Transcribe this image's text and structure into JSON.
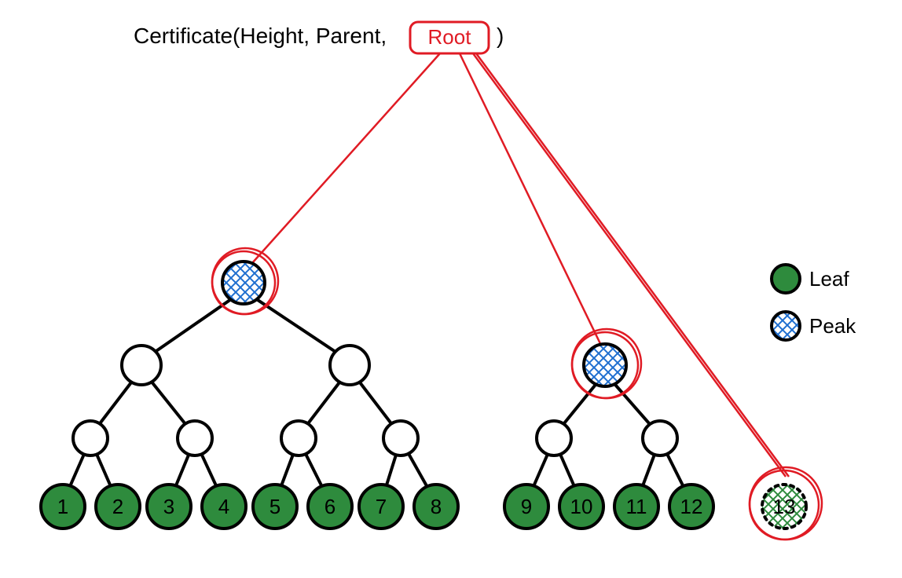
{
  "title": {
    "prefix": "Certificate(Height, Parent, ",
    "root": "Root",
    "suffix": ")"
  },
  "legend": {
    "leaf": "Leaf",
    "peak": "Peak"
  },
  "colors": {
    "leaf_fill": "#2e8b3d",
    "node_stroke": "#000000",
    "peak_hatch": "#1f6fd0",
    "root_red": "#e01b24",
    "dotted_hatch": "#2e8b3d"
  },
  "tree": {
    "leaves": [
      {
        "id": 1,
        "label": "1"
      },
      {
        "id": 2,
        "label": "2"
      },
      {
        "id": 3,
        "label": "3"
      },
      {
        "id": 4,
        "label": "4"
      },
      {
        "id": 5,
        "label": "5"
      },
      {
        "id": 6,
        "label": "6"
      },
      {
        "id": 7,
        "label": "7"
      },
      {
        "id": 8,
        "label": "8"
      },
      {
        "id": 9,
        "label": "9"
      },
      {
        "id": 10,
        "label": "10"
      },
      {
        "id": 11,
        "label": "11"
      },
      {
        "id": 12,
        "label": "12"
      },
      {
        "id": 13,
        "label": "13"
      }
    ],
    "peaks": [
      {
        "name": "peak-left",
        "covers": [
          1,
          2,
          3,
          4,
          5,
          6,
          7,
          8
        ]
      },
      {
        "name": "peak-mid",
        "covers": [
          9,
          10,
          11,
          12
        ]
      },
      {
        "name": "peak-right",
        "covers": [
          13
        ]
      }
    ],
    "root_connects_to": [
      "peak-left",
      "peak-mid",
      "peak-right"
    ]
  }
}
